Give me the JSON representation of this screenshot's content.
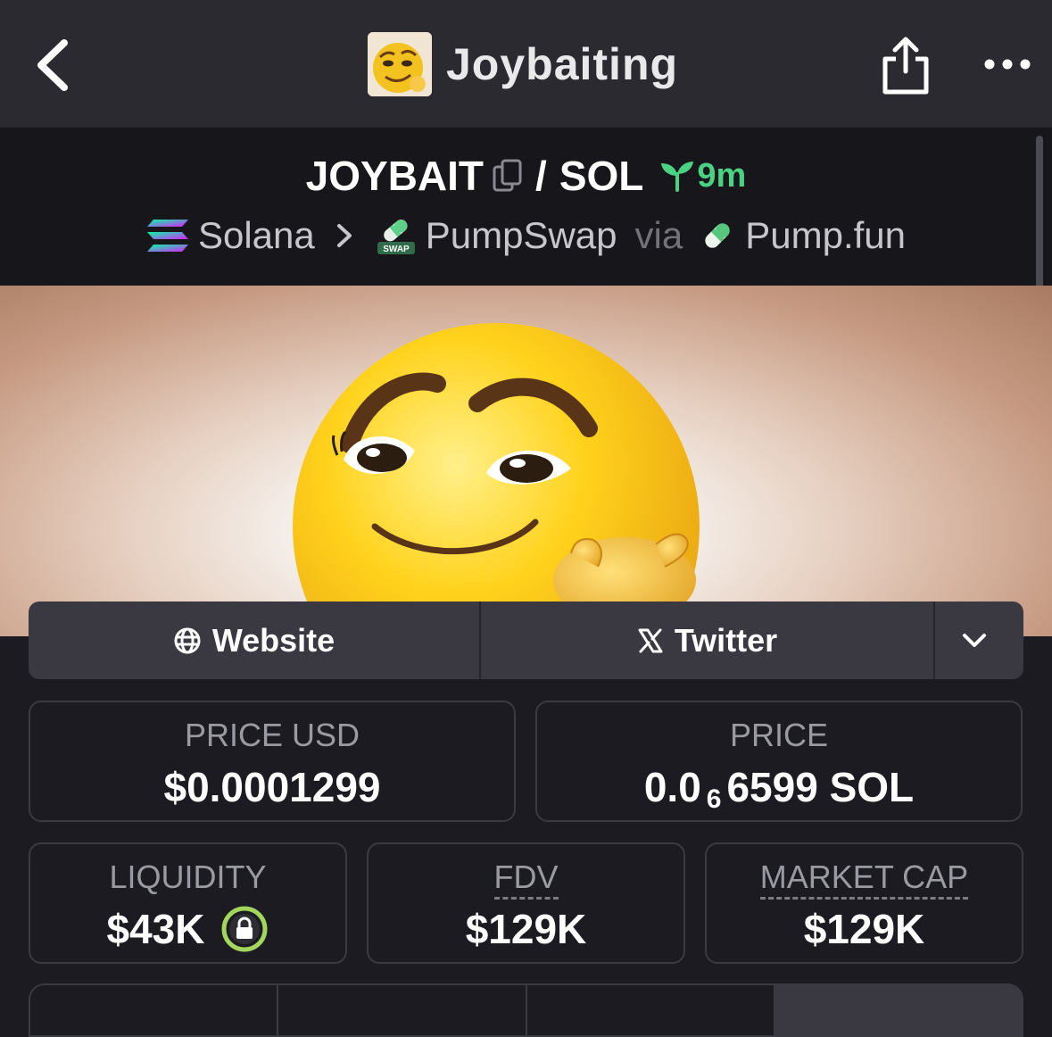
{
  "header": {
    "title": "Joybaiting",
    "back_icon": "chevron-left-icon",
    "share_icon": "share-icon",
    "more_icon": "more-dots-icon"
  },
  "pair": {
    "base": "JOYBAIT",
    "separator": "/",
    "quote": "SOL",
    "age": "9m"
  },
  "route": {
    "chain": "Solana",
    "dex": "PumpSwap",
    "via": "via",
    "launchpad": "Pump.fun"
  },
  "links": {
    "website": "Website",
    "twitter": "Twitter"
  },
  "stats": {
    "price_usd_label": "PRICE USD",
    "price_usd": "$0.0001299",
    "price_label": "PRICE",
    "price_prefix": "0.0",
    "price_zeros": "6",
    "price_digits": "6599 SOL",
    "liquidity_label": "LIQUIDITY",
    "liquidity": "$43K",
    "fdv_label": "FDV",
    "fdv": "$129K",
    "mcap_label": "MARKET CAP",
    "mcap": "$129K"
  },
  "colors": {
    "accent_green": "#4ad183",
    "lock_green": "#a3d65c",
    "background": "#1b1b21",
    "header": "#2b2a31"
  }
}
